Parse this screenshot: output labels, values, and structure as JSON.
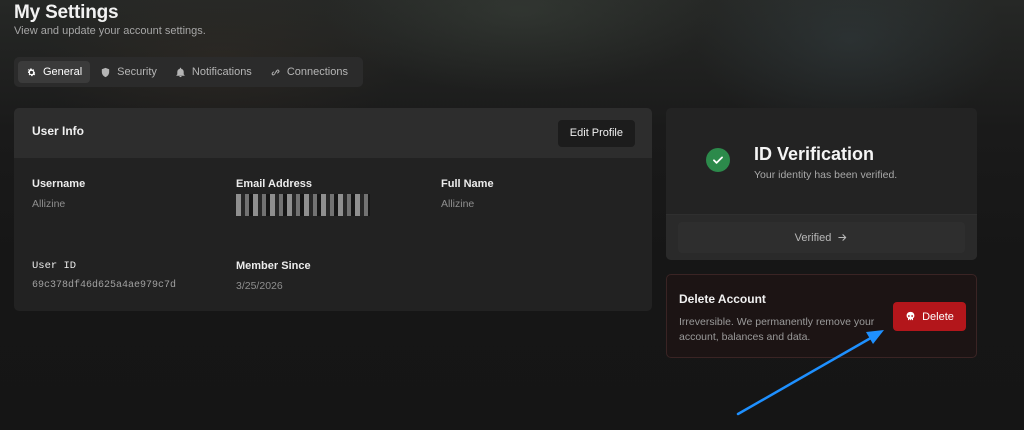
{
  "header": {
    "title": "My Settings",
    "subtitle": "View and update your account settings."
  },
  "tabs": [
    {
      "label": "General",
      "icon": "gear-icon",
      "active": true
    },
    {
      "label": "Security",
      "icon": "shield-icon",
      "active": false
    },
    {
      "label": "Notifications",
      "icon": "bell-icon",
      "active": false
    },
    {
      "label": "Connections",
      "icon": "link-icon",
      "active": false
    }
  ],
  "user_info": {
    "title": "User Info",
    "edit_label": "Edit Profile",
    "fields": {
      "username": {
        "label": "Username",
        "value": "Allizine"
      },
      "email": {
        "label": "Email Address",
        "value": ""
      },
      "full_name": {
        "label": "Full Name",
        "value": "Allizine"
      },
      "user_id": {
        "label": "User ID",
        "value": "69c378df46d625a4ae979c7d"
      },
      "member_since": {
        "label": "Member Since",
        "value": "3/25/2026"
      }
    }
  },
  "verification": {
    "title": "ID Verification",
    "description": "Your identity has been verified.",
    "status_label": "Verified"
  },
  "delete_account": {
    "title": "Delete Account",
    "description": "Irreversible. We permanently remove your account, balances and data.",
    "button_label": "Delete"
  },
  "colors": {
    "accent_danger": "#b3161b",
    "verified_green": "#2c8a4b",
    "annotation_arrow": "#1e90ff"
  }
}
